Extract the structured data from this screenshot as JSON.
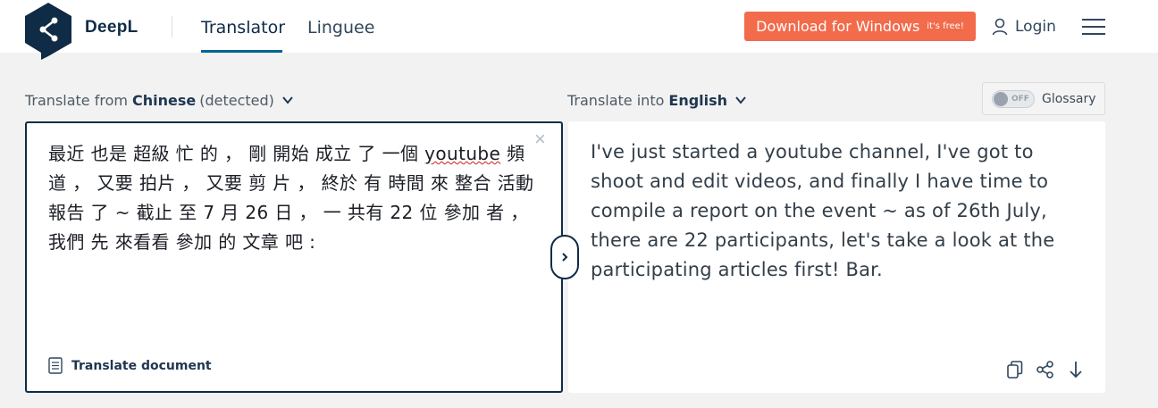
{
  "header": {
    "brand": "DeepL",
    "nav": [
      {
        "label": "Translator",
        "active": true
      },
      {
        "label": "Linguee",
        "active": false
      }
    ],
    "download": {
      "label": "Download for Windows",
      "badge": "it's free!"
    },
    "login_label": "Login"
  },
  "source": {
    "prefix": "Translate from",
    "language": "Chinese",
    "detected": "(detected)",
    "text_before": "最近 也是 超級 忙 的 ， 剛 開始 成立 了 一個 ",
    "text_spell": "youtube",
    "text_after": " 頻道 ， 又要 拍片 ， 又要 剪 片 ， 終於 有 時間 來 整合 活動 報告 了 ~ 截止 至 7 月 26 日 ， 一 共有 22 位 參加 者 ， 我們 先 來看看 參加 的 文章 吧 :",
    "clear_symbol": "×",
    "translate_document_label": "Translate document"
  },
  "target": {
    "prefix": "Translate into",
    "language": "English",
    "text": "I've just started a youtube channel, I've got to shoot and edit videos, and finally I have time to compile a report on the event ~ as of 26th July, there are 22 participants, let's take a look at the participating articles first! Bar."
  },
  "glossary": {
    "toggle_label": "OFF",
    "label": "Glossary"
  },
  "colors": {
    "brand_navy": "#0f2b46",
    "download_orange": "#f26b4b",
    "active_tab_underline": "#006494",
    "background": "#f2f2f2"
  }
}
